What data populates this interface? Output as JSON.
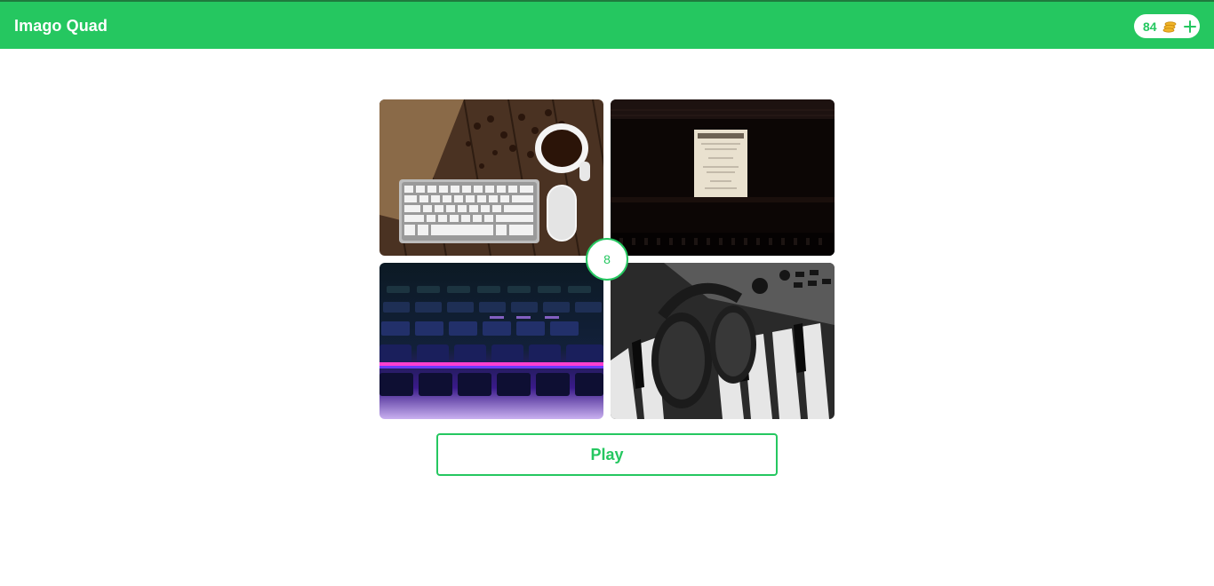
{
  "header": {
    "title": "Imago Quad",
    "coins": "84",
    "coin_icon": "coin-stack-icon",
    "add_icon": "plus-icon"
  },
  "puzzle": {
    "letter_count": "8",
    "images": [
      {
        "position": "top-left",
        "depicts": "keyboard, mouse and coffee cup on wooden desk"
      },
      {
        "position": "top-right",
        "depicts": "sheet music on piano"
      },
      {
        "position": "bottom-left",
        "depicts": "backlit RGB keyboard"
      },
      {
        "position": "bottom-right",
        "depicts": "headphones on piano keys"
      }
    ]
  },
  "actions": {
    "play_label": "Play"
  },
  "colors": {
    "accent": "#25c760",
    "header_border": "#1f7a3d",
    "coin": "#f0b429",
    "background": "#ffffff"
  }
}
